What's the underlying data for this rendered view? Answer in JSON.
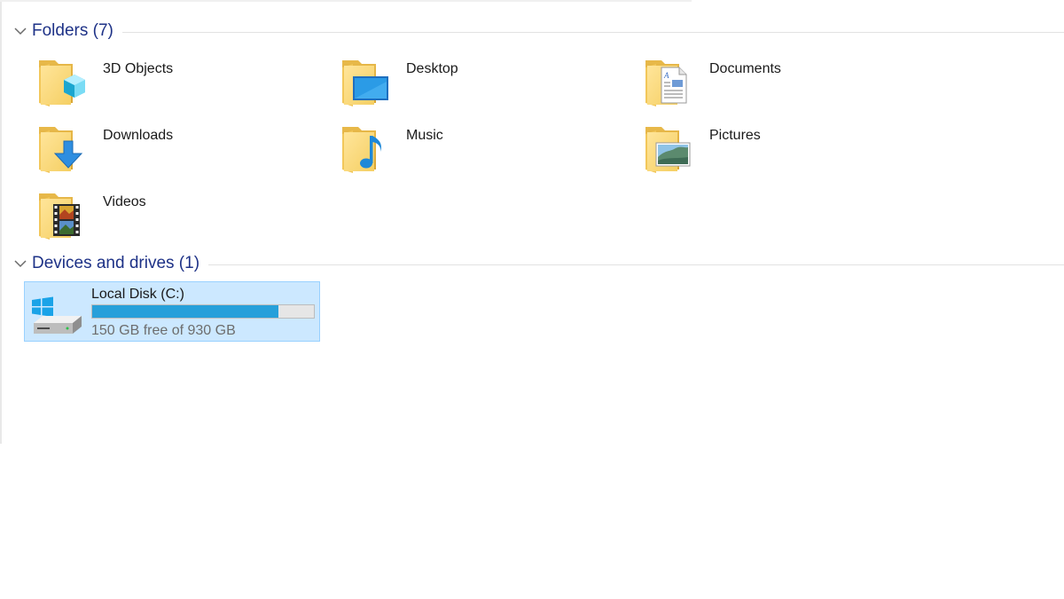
{
  "groups": {
    "folders": {
      "title": "Folders (7)"
    },
    "devices": {
      "title": "Devices and drives (1)"
    }
  },
  "folders": [
    {
      "label": "3D Objects",
      "icon": "3d-objects-folder-icon"
    },
    {
      "label": "Desktop",
      "icon": "desktop-folder-icon"
    },
    {
      "label": "Documents",
      "icon": "documents-folder-icon"
    },
    {
      "label": "Downloads",
      "icon": "downloads-folder-icon"
    },
    {
      "label": "Music",
      "icon": "music-folder-icon"
    },
    {
      "label": "Pictures",
      "icon": "pictures-folder-icon"
    },
    {
      "label": "Videos",
      "icon": "videos-folder-icon"
    }
  ],
  "drives": [
    {
      "name": "Local Disk (C:)",
      "free_text": "150 GB free of 930 GB",
      "used_fraction": 0.839,
      "icon": "windows-drive-icon",
      "selected": true
    }
  ],
  "colors": {
    "group_title": "#1e3287",
    "selection_bg": "#cce8ff",
    "selection_border": "#99d1ff",
    "usage_bar": "#26a0da",
    "folder_yellow": "#f8d775"
  }
}
